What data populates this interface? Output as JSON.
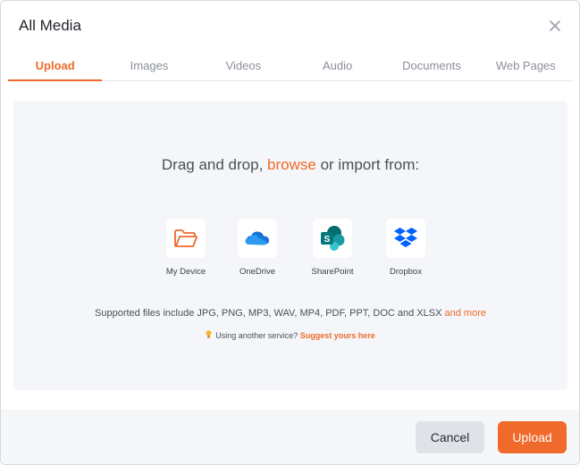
{
  "modal": {
    "title": "All Media",
    "close_icon": "close-icon"
  },
  "tabs": [
    {
      "label": "Upload",
      "active": true
    },
    {
      "label": "Images",
      "active": false
    },
    {
      "label": "Videos",
      "active": false
    },
    {
      "label": "Audio",
      "active": false
    },
    {
      "label": "Documents",
      "active": false
    },
    {
      "label": "Web Pages",
      "active": false
    }
  ],
  "dropzone": {
    "headline_before": "Drag and drop, ",
    "browse_link": "browse",
    "headline_after": " or import from:",
    "sources": [
      {
        "label": "My Device",
        "icon": "folder-icon"
      },
      {
        "label": "OneDrive",
        "icon": "onedrive-icon"
      },
      {
        "label": "SharePoint",
        "icon": "sharepoint-icon"
      },
      {
        "label": "Dropbox",
        "icon": "dropbox-icon"
      }
    ],
    "supported_text": "Supported files include JPG, PNG, MP3, WAV, MP4, PDF, PPT, DOC and XLSX ",
    "supported_more": "and more",
    "another_text": "Using another service? ",
    "another_link": "Suggest yours here"
  },
  "footer": {
    "cancel_label": "Cancel",
    "upload_label": "Upload"
  },
  "colors": {
    "accent": "#ef6a2b",
    "onedrive": "#1a73d9",
    "sharepoint": "#038387",
    "dropbox": "#0061fe"
  }
}
